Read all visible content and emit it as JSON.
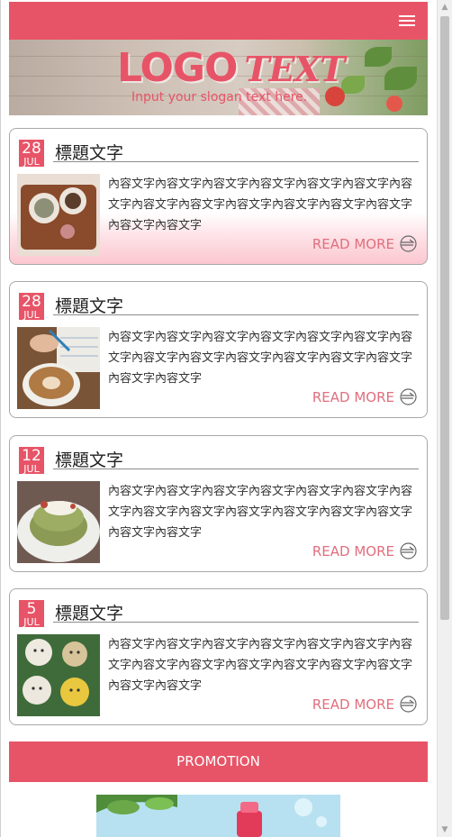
{
  "header": {
    "menu_icon": "hamburger-icon",
    "accent_color": "#e85467"
  },
  "banner": {
    "logo_main": "LOGO",
    "logo_script": "TEXT",
    "slogan": "Input your slogan text here."
  },
  "posts": [
    {
      "day": "28",
      "month": "JUL",
      "title": "標題文字",
      "body": "內容文字內容文字內容文字內容文字內容文字內容文字內容文字內容文字內容文字內容文字內容文字內容文字內容文字內容文字內容文字",
      "read_more": "READ MORE",
      "image": "coffee-cups-on-tray-photo"
    },
    {
      "day": "28",
      "month": "JUL",
      "title": "標題文字",
      "body": "內容文字內容文字內容文字內容文字內容文字內容文字內容文字內容文字內容文字內容文字內容文字內容文字內容文字內容文字內容文字",
      "read_more": "READ MORE",
      "image": "latte-and-notebook-photo"
    },
    {
      "day": "12",
      "month": "JUL",
      "title": "標題文字",
      "body": "內容文字內容文字內容文字內容文字內容文字內容文字內容文字內容文字內容文字內容文字內容文字內容文字內容文字內容文字內容文字",
      "read_more": "READ MORE",
      "image": "matcha-pancakes-photo"
    },
    {
      "day": "5",
      "month": "JUL",
      "title": "標題文字",
      "body": "內容文字內容文字內容文字內容文字內容文字內容文字內容文字內容文字內容文字內容文字內容文字內容文字內容文字內容文字內容文字",
      "read_more": "READ MORE",
      "image": "latte-art-faces-photo"
    }
  ],
  "promo": {
    "label": "PROMOTION"
  },
  "ad": {
    "image": "cosmetics-ad-banner"
  }
}
